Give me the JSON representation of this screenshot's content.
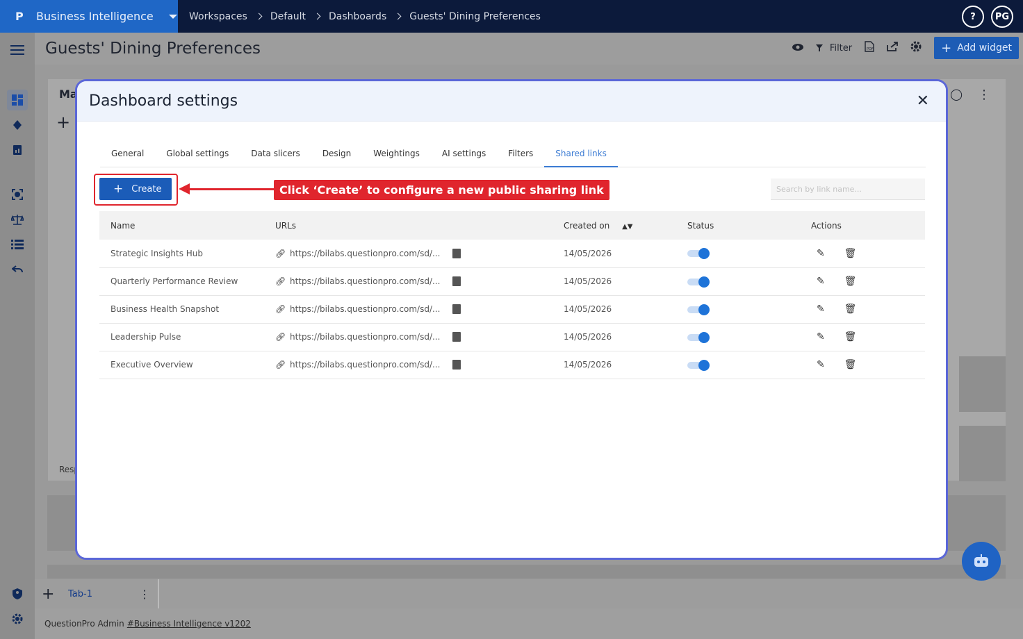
{
  "topbar": {
    "brand": "Business Intelligence",
    "breadcrumbs": [
      "Workspaces",
      "Default",
      "Dashboards",
      "Guests' Dining Preferences"
    ],
    "help": "?",
    "avatar": "PG"
  },
  "page": {
    "title": "Guests' Dining Preferences",
    "filter_label": "Filter",
    "add_widget_label": "Add widget"
  },
  "background": {
    "card_title_fragment": "Ma",
    "card_footer_fragment": "Resp",
    "tab_label": "Tab-1"
  },
  "footer": {
    "text": "QuestionPro Admin",
    "link": "#Business Intelligence v1202"
  },
  "modal": {
    "title": "Dashboard settings",
    "tabs": [
      "General",
      "Global settings",
      "Data slicers",
      "Design",
      "Weightings",
      "AI settings",
      "Filters",
      "Shared links"
    ],
    "active_tab": "Shared links",
    "create_label": "Create",
    "callout": "Click ‘Create’ to configure a new public sharing link",
    "search_placeholder": "Search by link name...",
    "columns": [
      "Name",
      "URLs",
      "Created on",
      "Status",
      "Actions"
    ],
    "rows": [
      {
        "name": "Strategic Insights Hub",
        "url": "https://bilabs.questionpro.com/sd/...",
        "created": "14/05/2026",
        "enabled": true
      },
      {
        "name": "Quarterly Performance Review",
        "url": "https://bilabs.questionpro.com/sd/...",
        "created": "14/05/2026",
        "enabled": true
      },
      {
        "name": "Business Health Snapshot",
        "url": "https://bilabs.questionpro.com/sd/...",
        "created": "14/05/2026",
        "enabled": true
      },
      {
        "name": "Leadership Pulse",
        "url": "https://bilabs.questionpro.com/sd/...",
        "created": "14/05/2026",
        "enabled": true
      },
      {
        "name": "Executive Overview",
        "url": "https://bilabs.questionpro.com/sd/...",
        "created": "14/05/2026",
        "enabled": true
      }
    ]
  },
  "colors": {
    "brand_blue": "#1f67c6",
    "nav_dark": "#0c1a3b",
    "accent": "#3b7bd3",
    "callout_red": "#e0252d",
    "modal_border": "#5b67d8"
  }
}
